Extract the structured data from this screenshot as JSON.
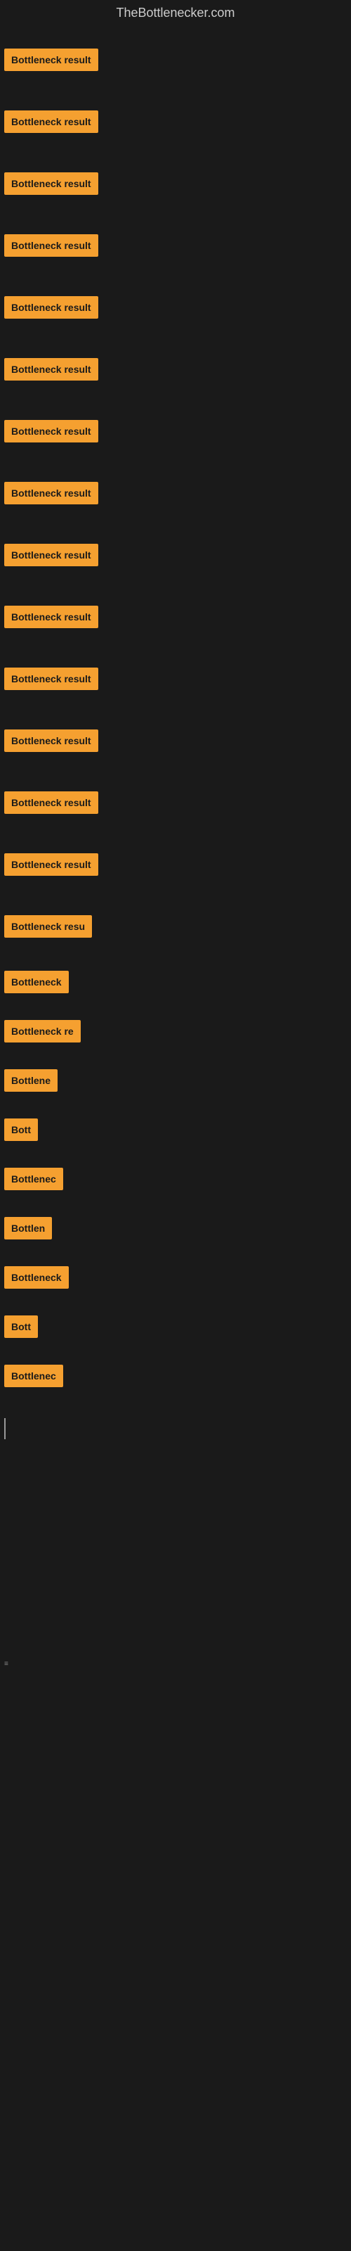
{
  "site": {
    "title": "TheBottlenecker.com"
  },
  "rows": [
    {
      "id": 1,
      "label": "Bottleneck result",
      "width": 140,
      "visible": true
    },
    {
      "id": 2,
      "label": "Bottleneck result",
      "width": 140,
      "visible": true
    },
    {
      "id": 3,
      "label": "Bottleneck result",
      "width": 140,
      "visible": true
    },
    {
      "id": 4,
      "label": "Bottleneck result",
      "width": 140,
      "visible": true
    },
    {
      "id": 5,
      "label": "Bottleneck result",
      "width": 140,
      "visible": true
    },
    {
      "id": 6,
      "label": "Bottleneck result",
      "width": 140,
      "visible": true
    },
    {
      "id": 7,
      "label": "Bottleneck result",
      "width": 140,
      "visible": true
    },
    {
      "id": 8,
      "label": "Bottleneck result",
      "width": 140,
      "visible": true
    },
    {
      "id": 9,
      "label": "Bottleneck result",
      "width": 140,
      "visible": true
    },
    {
      "id": 10,
      "label": "Bottleneck result",
      "width": 140,
      "visible": true
    },
    {
      "id": 11,
      "label": "Bottleneck result",
      "width": 140,
      "visible": true
    },
    {
      "id": 12,
      "label": "Bottleneck result",
      "width": 140,
      "visible": true
    },
    {
      "id": 13,
      "label": "Bottleneck result",
      "width": 140,
      "visible": true
    },
    {
      "id": 14,
      "label": "Bottleneck result",
      "width": 140,
      "visible": true
    },
    {
      "id": 15,
      "label": "Bottleneck resu",
      "width": 120,
      "visible": true
    },
    {
      "id": 16,
      "label": "Bottleneck",
      "width": 90,
      "visible": true
    },
    {
      "id": 17,
      "label": "Bottleneck re",
      "width": 105,
      "visible": true
    },
    {
      "id": 18,
      "label": "Bottlene",
      "width": 80,
      "visible": true
    },
    {
      "id": 19,
      "label": "Bott",
      "width": 50,
      "visible": true
    },
    {
      "id": 20,
      "label": "Bottlenec",
      "width": 88,
      "visible": true
    },
    {
      "id": 21,
      "label": "Bottlen",
      "width": 72,
      "visible": true
    },
    {
      "id": 22,
      "label": "Bottleneck",
      "width": 90,
      "visible": true
    },
    {
      "id": 23,
      "label": "Bott",
      "width": 50,
      "visible": true
    },
    {
      "id": 24,
      "label": "Bottlenec",
      "width": 88,
      "visible": true
    }
  ],
  "colors": {
    "accent": "#f5a030",
    "background": "#1a1a1a",
    "text_dark": "#1a1a1a",
    "text_light": "#cccccc"
  }
}
